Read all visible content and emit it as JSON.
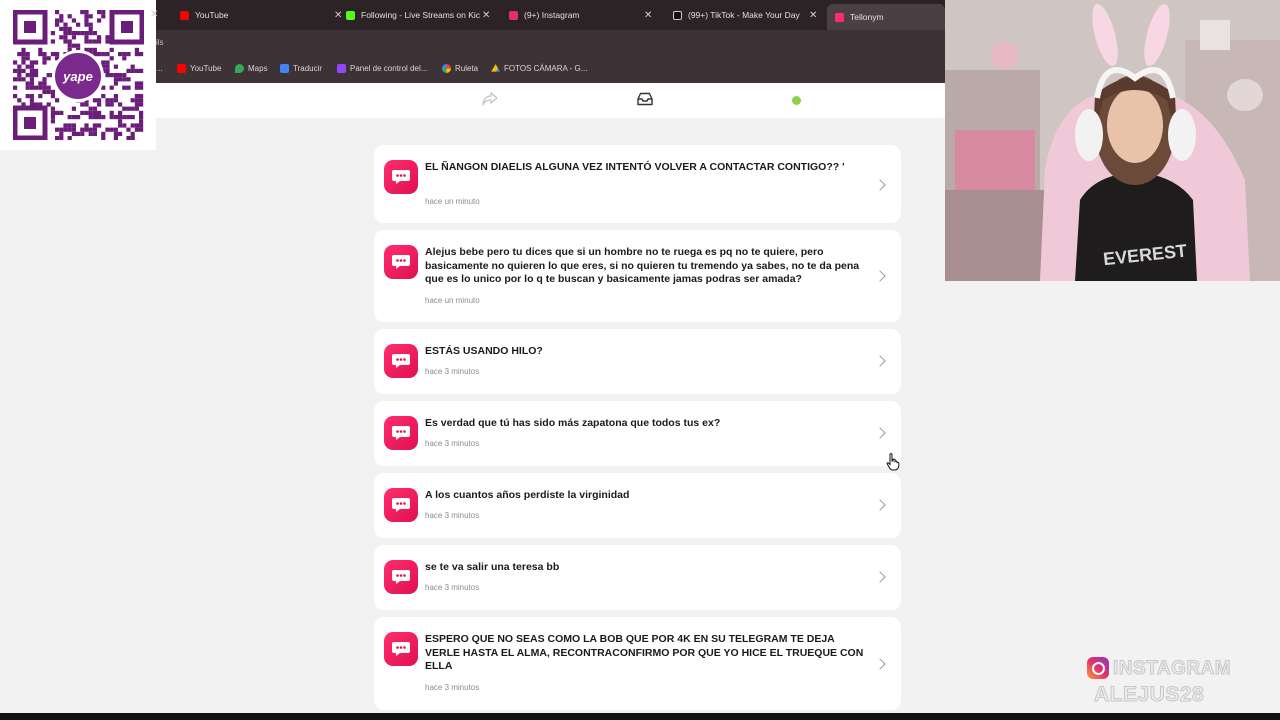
{
  "tabs": [
    {
      "title": "YouTube",
      "favicon_color": "#ff0000",
      "active": false
    },
    {
      "title": "Following - Live Streams on Kic",
      "favicon_color": "#53fc18",
      "active": false
    },
    {
      "title": "(9+) Instagram",
      "favicon_color": "#e1306c",
      "active": false
    },
    {
      "title": "(99+) TikTok - Make Your Day",
      "favicon_color": "#111111",
      "active": false
    },
    {
      "title": "Tellonym",
      "favicon_color": "#ff2d6f",
      "active": true
    }
  ],
  "address_fragment": "ils",
  "bookmarks": [
    {
      "label": "YouTube",
      "icon": "youtube-icon",
      "color": "#ff0000"
    },
    {
      "label": "Maps",
      "icon": "maps-icon",
      "color": "#34a853"
    },
    {
      "label": "Traducir",
      "icon": "translate-icon",
      "color": "#4285f4"
    },
    {
      "label": "Panel de control del...",
      "icon": "twitch-icon",
      "color": "#9146ff"
    },
    {
      "label": "Ruleta",
      "icon": "roulette-icon",
      "color": "#fbbc05"
    },
    {
      "label": "FOTOS CÁMARA - G...",
      "icon": "drive-icon",
      "color": "#0f9d58"
    }
  ],
  "qr": {
    "logo_text": "yape",
    "logo_color": "#7a2a8c"
  },
  "messages": [
    {
      "text": "EL ÑANGON DIAELIS ALGUNA VEZ INTENTÓ VOLVER A CONTACTAR  CONTIGO?? '",
      "time": "hace un minuto"
    },
    {
      "text": "Alejus bebe pero tu dices que si un hombre no te ruega es pq no te quiere, pero basicamente no quieren lo que eres, si no quieren tu tremendo ya sabes, no te da pena que es lo unico por lo q te buscan y basicamente jamas podras ser amada?",
      "time": "hace un minuto"
    },
    {
      "text": "ESTÁS USANDO HILO?",
      "time": "hace 3 minutos"
    },
    {
      "text": "Es verdad que tú has sido más zapatona que todos tus ex?",
      "time": "hace 3 minutos"
    },
    {
      "text": "A los cuantos años perdiste la virginidad",
      "time": "hace 3 minutos"
    },
    {
      "text": "se te va salir una teresa bb",
      "time": "hace 3 minutos"
    },
    {
      "text": "ESPERO QUE NO SEAS COMO LA BOB QUE POR 4K EN SU TELEGRAM TE DEJA VERLE HASTA EL ALMA, RECONTRACONFIRMO POR QUE YO HICE EL TRUEQUE CON ELLA",
      "time": "hace 3 minutos"
    }
  ],
  "overlay": {
    "label": "INSTAGRAM",
    "handle": "ALEJUS28"
  },
  "colors": {
    "accent": "#ff2d6f",
    "status_dot": "#8bd34a"
  }
}
